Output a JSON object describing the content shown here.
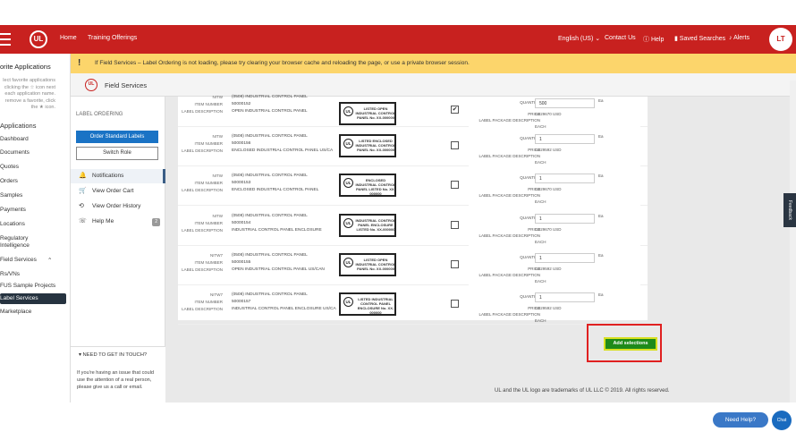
{
  "topbar": {
    "home": "Home",
    "training": "Training Offerings",
    "language": "English (US) ⌄",
    "contact": "Contact Us",
    "help": "Help",
    "saved": "Saved Searches",
    "alerts": "Alerts",
    "avatar": "LT",
    "logo": "UL"
  },
  "banner": {
    "icon": "!",
    "text": "If Field Services – Label Ordering is not loading, please try clearing your browser cache and reloading the page, or use a private browser session."
  },
  "favs": {
    "title": "orite Applications",
    "hint": "lect favorite applications clicking the ☆ icon next each application name. remove a favorite, click the ★ icon.",
    "apps_title": "Applications",
    "apps": [
      "Dashboard",
      "Documents",
      "Quotes",
      "Orders",
      "Samples",
      "Payments",
      "Locations",
      "Regulatory Intelligence",
      "Field Services",
      "Rs/VNs",
      "FUS Sample Projects",
      "Label Services",
      "Marketplace"
    ]
  },
  "crumb": {
    "title": "Field Services",
    "logo": "UL"
  },
  "menu": {
    "heading": "LABEL ORDERING",
    "order_btn": "Order Standard Labels",
    "switch_btn": "Switch Role",
    "items": [
      {
        "icon": "🔔",
        "label": "Notifications"
      },
      {
        "icon": "🛒",
        "label": "View Order Cart"
      },
      {
        "icon": "⟲",
        "label": "View Order History"
      },
      {
        "icon": "☏",
        "label": "Help Me",
        "badge": "2"
      }
    ]
  },
  "touch": {
    "heading": "▾ NEED TO GET IN TOUCH?",
    "body": "If you're having an issue that could use the attention of a real person, please give us a call or email."
  },
  "rows": [
    {
      "code": "NITW",
      "desc_top": "(0508) INDUSTRIAL CONTROL PANEL",
      "item_no": "50000152",
      "label_desc": "OPEN INDUSTRIAL CONTROL PANEL",
      "lbl": "LISTED OPEN INDUSTRIAL CONTROL PANEL No. XX-000000",
      "checked": "✔",
      "qty": "500",
      "price": "0.029670 USD",
      "pkg": "EACH"
    },
    {
      "code": "NITW",
      "desc_top": "(0508) INDUSTRIAL CONTROL PANEL",
      "item_no": "50000156",
      "label_desc": "ENCLOSED INDUSTRIAL CONTROL PANEL US/CA",
      "lbl": "LISTED ENCLOSED INDUSTRIAL CONTROL PANEL No. XX-000000",
      "checked": "",
      "qty": "1",
      "price": "0.029592 USD",
      "pkg": "EACH"
    },
    {
      "code": "NITW",
      "desc_top": "(0508) INDUSTRIAL CONTROL PANEL",
      "item_no": "50000153",
      "label_desc": "ENCLOSED INDUSTRIAL CONTROL PANEL",
      "lbl": "ENCLOSED INDUSTRIAL CONTROL PANEL LISTED No. XX-000000",
      "checked": "",
      "qty": "1",
      "price": "0.029670 USD",
      "pkg": "EACH"
    },
    {
      "code": "NITW",
      "desc_top": "(0508) INDUSTRIAL CONTROL PANEL",
      "item_no": "50000154",
      "label_desc": "INDUSTRIAL CONTROL PANEL ENCLOSURE",
      "lbl": "INDUSTRIAL CONTROL PANEL ENCLOSURE LISTED No. XX-000000",
      "checked": "",
      "qty": "1",
      "price": "0.029670 USD",
      "pkg": "EACH"
    },
    {
      "code": "NITW7",
      "desc_top": "(0508) INDUSTRIAL CONTROL PANEL",
      "item_no": "50000155",
      "label_desc": "OPEN INDUSTRIAL CONTROL PANEL US/CAN",
      "lbl": "LISTED OPEN INDUSTRIAL CONTROL PANEL No. XX-000000",
      "checked": "",
      "qty": "1",
      "price": "0.029592 USD",
      "pkg": "EACH"
    },
    {
      "code": "NITW7",
      "desc_top": "(0508) INDUSTRIAL CONTROL PANEL",
      "item_no": "50000157",
      "label_desc": "INDUSTRIAL CONTROL PANEL ENCLOSURE US/CA",
      "lbl": "LISTED INDUSTRIAL CONTROL PANEL ENCLOSURE No. XX-000000",
      "checked": "",
      "qty": "1",
      "price": "0.029592 USD",
      "pkg": "EACH"
    }
  ],
  "labels": {
    "item_number": "ITEM NUMBER",
    "label_description": "LABEL DESCRIPTION",
    "quantity": "QUANTITY",
    "price": "PRICE",
    "pkg_desc": "LABEL PACKAGE DESCRIPTION",
    "ea": "Ea"
  },
  "add_btn": "Add selections",
  "copyright": "UL and the UL logo are trademarks of UL LLC © 2019. All rights reserved.",
  "feedback": "Feedback",
  "need_help": "Need Help?",
  "chat": "Chat"
}
